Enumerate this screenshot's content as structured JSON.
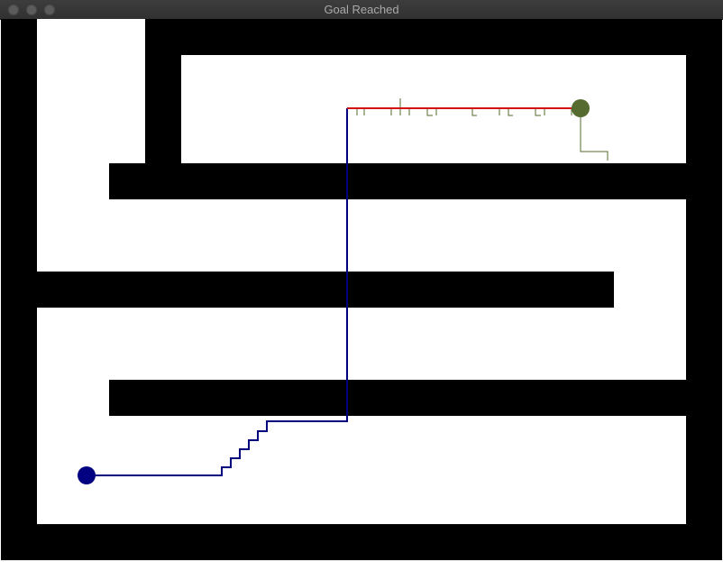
{
  "window": {
    "title": "Goal Reached"
  },
  "colors": {
    "wall": "#000000",
    "free": "#ffffff",
    "path": "#00007f",
    "final_segment": "#d21212",
    "goal": "#556b2f",
    "start": "#000080",
    "tree": "#556b2f"
  },
  "icons": {
    "close": "circle",
    "minimize": "circle",
    "zoom": "circle"
  }
}
